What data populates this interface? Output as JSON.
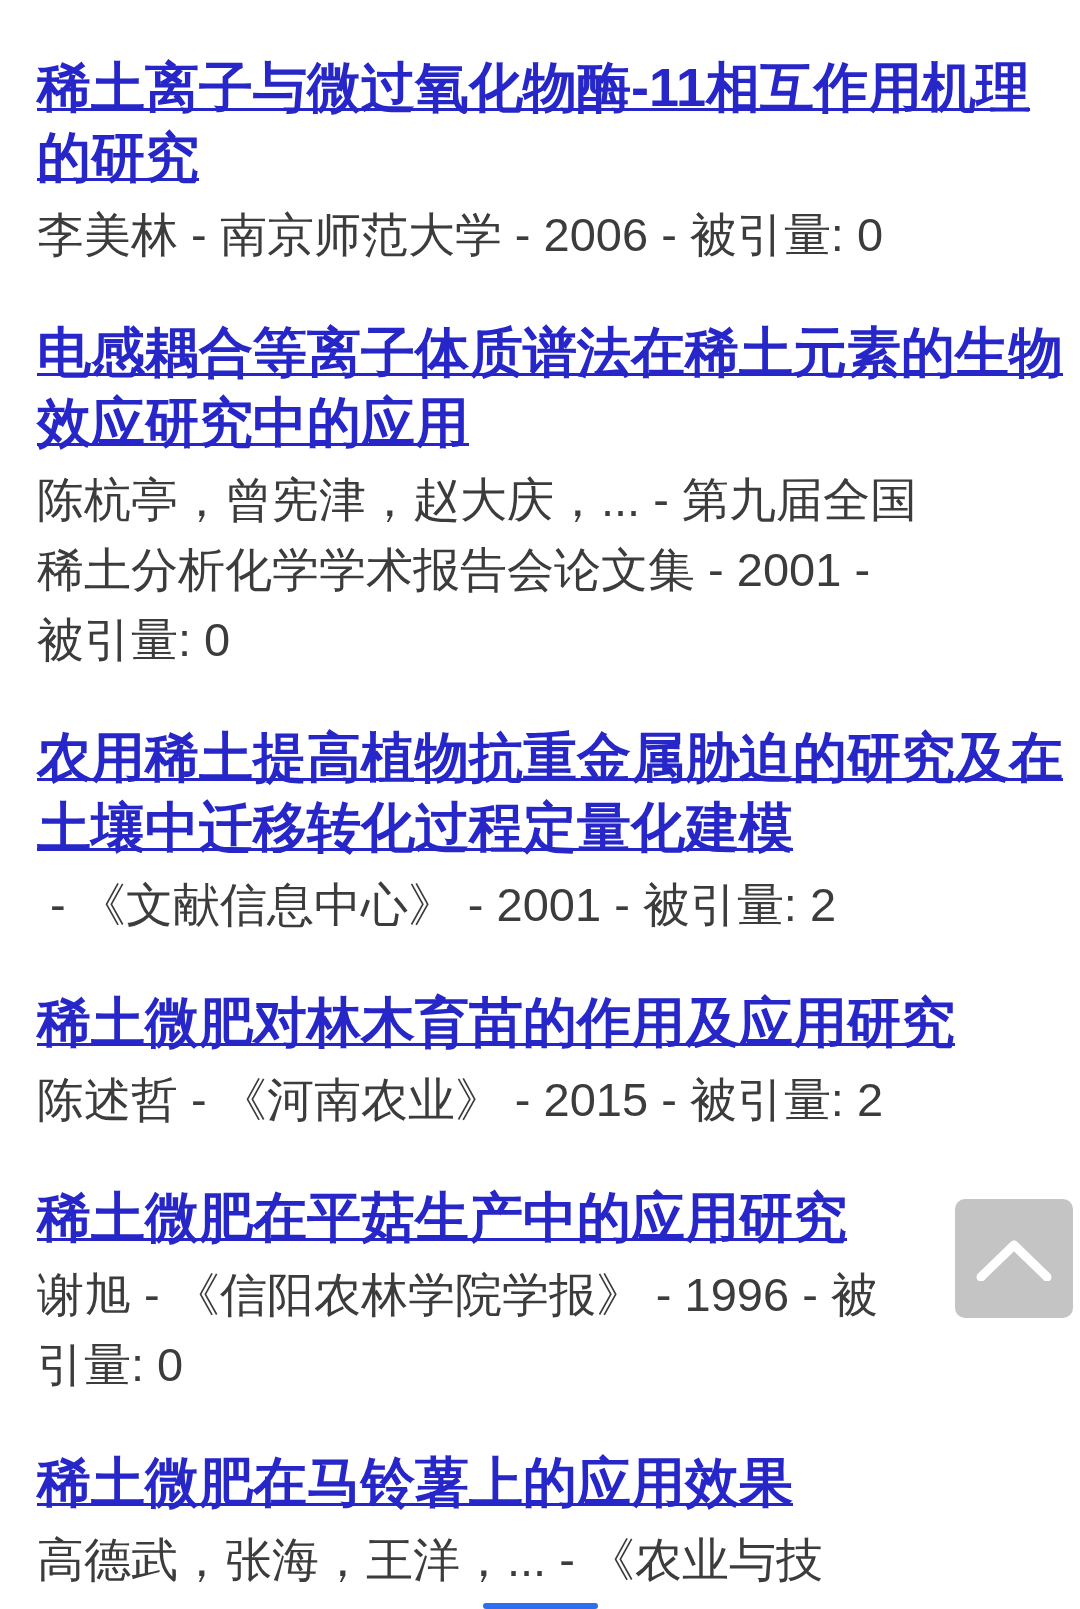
{
  "results": [
    {
      "title": "稀土离子与微过氧化物酶-11相互作用机理的研究",
      "meta": "李美林 - 南京师范大学 - 2006 - 被引量: 0"
    },
    {
      "title": "电感耦合等离子体质谱法在稀土元素的生物效应研究中的应用",
      "meta": "陈杭亭，曾宪津，赵大庆，... - 第九届全国稀土分析化学学术报告会论文集 - 2001 - 被引量: 0"
    },
    {
      "title": "农用稀土提高植物抗重金属胁迫的研究及在土壤中迁移转化过程定量化建模",
      "meta": " - 《文献信息中心》 - 2001 - 被引量: 2"
    },
    {
      "title": "稀土微肥对林木育苗的作用及应用研究",
      "meta": "陈述哲 - 《河南农业》 - 2015 - 被引量: 2"
    },
    {
      "title": "稀土微肥在平菇生产中的应用研究",
      "meta": "谢旭 - 《信阳农林学院学报》 - 1996 - 被引量: 0"
    },
    {
      "title": "稀土微肥在马铃薯上的应用效果",
      "meta": "高德武，张海，王洋，... - 《农业与技"
    }
  ]
}
